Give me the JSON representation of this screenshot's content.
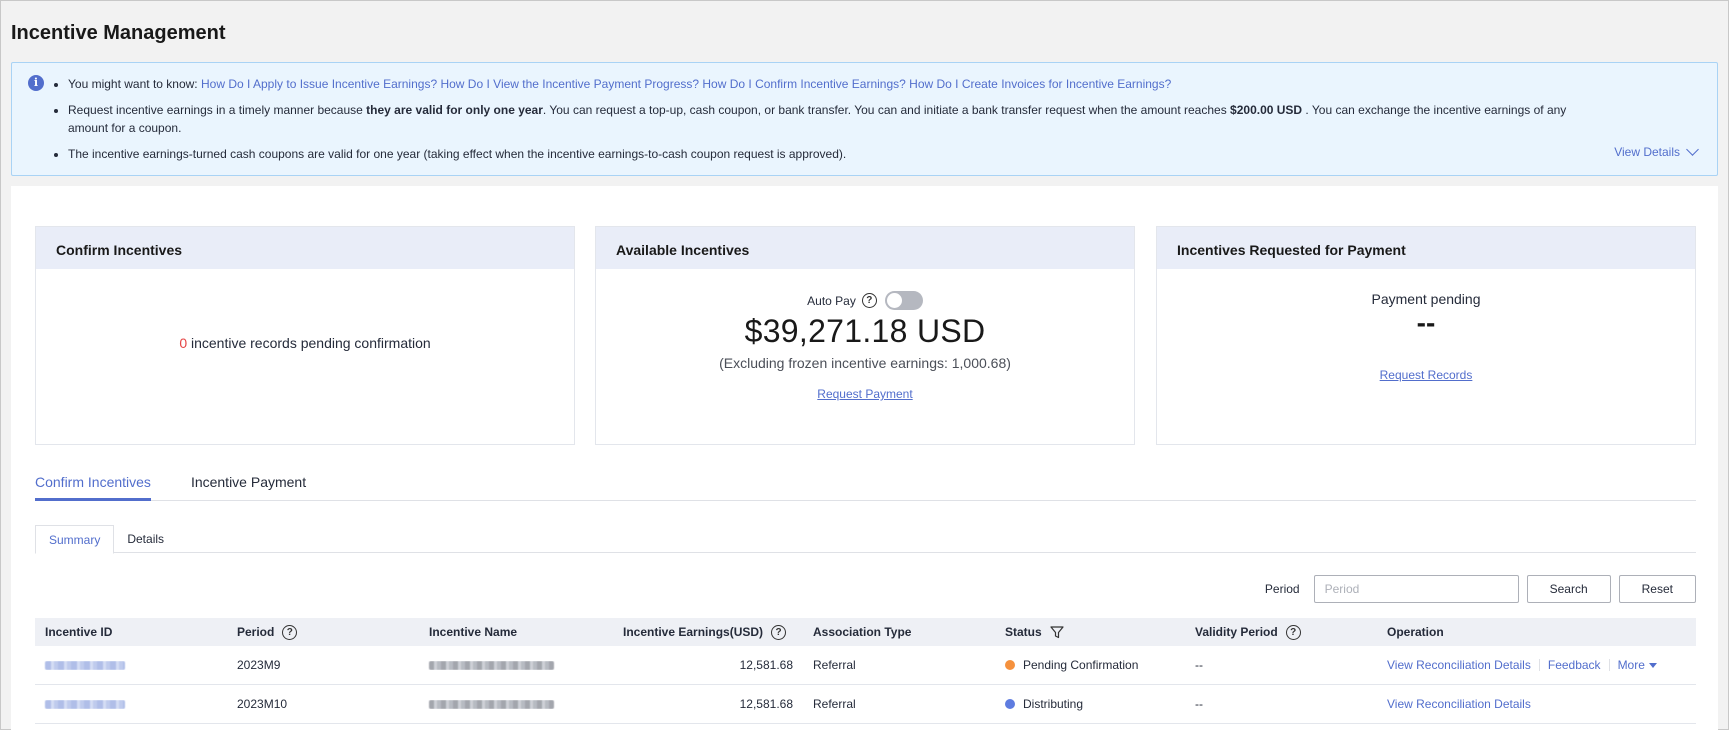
{
  "page": {
    "title": "Incentive Management"
  },
  "notice": {
    "lead": "You might want to know:",
    "links": [
      "How Do I Apply to Issue Incentive Earnings?",
      "How Do I View the Incentive Payment Progress?",
      "How Do I Confirm Incentive Earnings?",
      "How Do I Create Invoices for Incentive Earnings?"
    ],
    "bullet2_part1": "Request incentive earnings in a timely manner because ",
    "bullet2_bold1": "they are valid for only one year",
    "bullet2_part2": ". You can request a top-up, cash coupon, or bank transfer. You can and initiate a bank transfer request when the amount reaches ",
    "bullet2_bold2": "$200.00 USD",
    "bullet2_part3": " . You can exchange the incentive earnings of any amount for a coupon.",
    "bullet3": "The incentive earnings-turned cash coupons are valid for one year (taking effect when the incentive earnings-to-cash coupon request is approved).",
    "view_details": "View Details"
  },
  "cards": {
    "confirm": {
      "title": "Confirm Incentives",
      "count": "0",
      "text": " incentive records pending confirmation"
    },
    "available": {
      "title": "Available Incentives",
      "auto_pay_label": "Auto Pay",
      "amount": "$39,271.18 USD",
      "excluding": "(Excluding frozen incentive earnings: 1,000.68)",
      "request_link": "Request Payment"
    },
    "requested": {
      "title": "Incentives Requested for Payment",
      "label": "Payment pending",
      "value": "--",
      "link": "Request Records"
    }
  },
  "tabs": [
    "Confirm Incentives",
    "Incentive Payment"
  ],
  "subtabs": [
    "Summary",
    "Details"
  ],
  "filter": {
    "label": "Period",
    "placeholder": "Period",
    "search": "Search",
    "reset": "Reset"
  },
  "table": {
    "headers": [
      "Incentive ID",
      "Period",
      "Incentive Name",
      "Incentive Earnings(USD)",
      "Association Type",
      "Status",
      "Validity Period",
      "Operation"
    ],
    "rows": [
      {
        "period": "2023M9",
        "earnings": "12,581.68",
        "association": "Referral",
        "status": "Pending Confirmation",
        "status_color": "#f5913d",
        "validity": "--",
        "ops": [
          "View Reconciliation Details",
          "Feedback",
          "More"
        ]
      },
      {
        "period": "2023M10",
        "earnings": "12,581.68",
        "association": "Referral",
        "status": "Distributing",
        "status_color": "#5e7ce0",
        "validity": "--",
        "ops": [
          "View Reconciliation Details"
        ]
      }
    ]
  },
  "colors": {
    "accent": "#526ecc",
    "danger": "#e54545"
  }
}
